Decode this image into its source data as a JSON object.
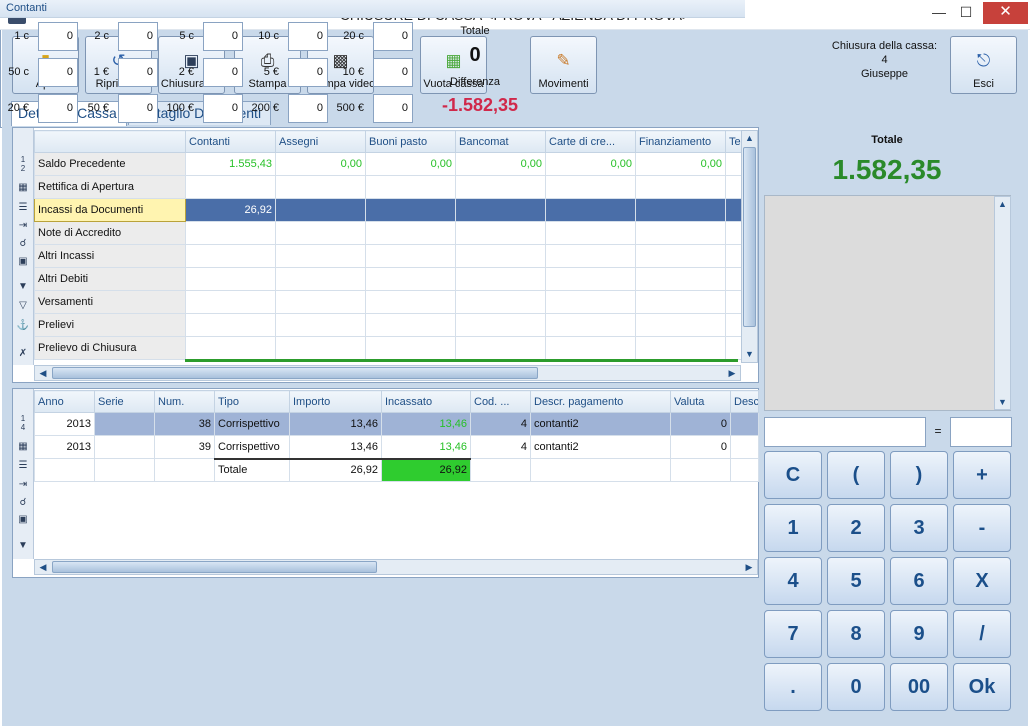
{
  "window": {
    "title": "CHIUSURE DI CASSA <PROVA - AZIENDA DI PROVA>",
    "icon_text": "B",
    "min_icon": "minimize-icon",
    "max_icon": "maximize-icon",
    "close_icon": "close-icon"
  },
  "toolbar": {
    "apri": "Apri",
    "ripristina": "Ripristina",
    "chiusura_fis": "Chiusura fis.",
    "stampa": "Stampa",
    "stampa_video": "Stampa video",
    "vuota_cassa": "Vuota cassa",
    "movimenti": "Movimenti",
    "esci": "Esci"
  },
  "closure_info": {
    "label": "Chiusura della cassa:",
    "number": "4",
    "user": "Giuseppe"
  },
  "tabs": {
    "cassa": "Dettaglio Cassa",
    "documenti": "Dettaglio Documenti"
  },
  "cassa_grid": {
    "columns": [
      "Contanti",
      "Assegni",
      "Buoni pasto",
      "Bancomat",
      "Carte di cre...",
      "Finanziamento",
      "Te"
    ],
    "row_numbers": [
      "1",
      "2"
    ],
    "rows": [
      {
        "label": "Saldo Precedente",
        "values": [
          "1.555,43",
          "0,00",
          "0,00",
          "0,00",
          "0,00",
          "0,00",
          ""
        ]
      },
      {
        "label": "Rettifica di Apertura",
        "values": [
          "",
          "",
          "",
          "",
          "",
          "",
          ""
        ]
      },
      {
        "label": "Incassi da Documenti",
        "values": [
          "26,92",
          "",
          "",
          "",
          "",
          "",
          ""
        ]
      },
      {
        "label": "Note di Accredito",
        "values": [
          "",
          "",
          "",
          "",
          "",
          "",
          ""
        ]
      },
      {
        "label": "Altri Incassi",
        "values": [
          "",
          "",
          "",
          "",
          "",
          "",
          ""
        ]
      },
      {
        "label": "Altri Debiti",
        "values": [
          "",
          "",
          "",
          "",
          "",
          "",
          ""
        ]
      },
      {
        "label": "Versamenti",
        "values": [
          "",
          "",
          "",
          "",
          "",
          "",
          ""
        ]
      },
      {
        "label": "Prelievi",
        "values": [
          "",
          "",
          "",
          "",
          "",
          "",
          ""
        ]
      },
      {
        "label": "Prelievo di Chiusura",
        "values": [
          "",
          "",
          "",
          "",
          "",
          "",
          ""
        ]
      }
    ]
  },
  "docs_grid": {
    "columns": [
      "Anno",
      "Serie",
      "Num.",
      "Tipo",
      "Importo",
      "Incassato",
      "Cod. ...",
      "Descr. pagamento",
      "Valuta",
      "Desc"
    ],
    "row_numbers": [
      "1",
      "4"
    ],
    "rows": [
      {
        "anno": "2013",
        "serie": "",
        "num": "38",
        "tipo": "Corrispettivo",
        "importo": "13,46",
        "incassato": "13,46",
        "cod": "4",
        "descr": "contanti2",
        "valuta": "0"
      },
      {
        "anno": "2013",
        "serie": "",
        "num": "39",
        "tipo": "Corrispettivo",
        "importo": "13,46",
        "incassato": "13,46",
        "cod": "4",
        "descr": "contanti2",
        "valuta": "0"
      }
    ],
    "total_label": "Totale",
    "total_importo": "26,92",
    "total_incassato": "26,92"
  },
  "totale": {
    "label": "Totale",
    "value": "1.582,35"
  },
  "calculator": {
    "equals": "=",
    "keys": [
      "C",
      "(",
      ")",
      "+",
      "1",
      "2",
      "3",
      "-",
      "4",
      "5",
      "6",
      "X",
      "7",
      "8",
      "9",
      "/",
      ".",
      "0",
      "00",
      "Ok"
    ]
  },
  "contanti": {
    "header": "Contanti",
    "denominations": [
      {
        "label": "1 c",
        "value": "0"
      },
      {
        "label": "2 c",
        "value": "0"
      },
      {
        "label": "5 c",
        "value": "0"
      },
      {
        "label": "10 c",
        "value": "0"
      },
      {
        "label": "20 c",
        "value": "0"
      },
      {
        "label": "50 c",
        "value": "0"
      },
      {
        "label": "1 €",
        "value": "0"
      },
      {
        "label": "2 €",
        "value": "0"
      },
      {
        "label": "5 €",
        "value": "0"
      },
      {
        "label": "10 €",
        "value": "0"
      },
      {
        "label": "20 €",
        "value": "0"
      },
      {
        "label": "50 €",
        "value": "0"
      },
      {
        "label": "100 €",
        "value": "0"
      },
      {
        "label": "200 €",
        "value": "0"
      },
      {
        "label": "500 €",
        "value": "0"
      }
    ],
    "totale_label": "Totale",
    "totale_value": "0",
    "differenza_label": "Differenza",
    "differenza_value": "-1.582,35"
  },
  "colors": {
    "accent": "#1f4f86",
    "positive": "#27c027",
    "total": "#2a8a2a",
    "negative": "#d0284a",
    "selection": "#4a6ea8"
  }
}
